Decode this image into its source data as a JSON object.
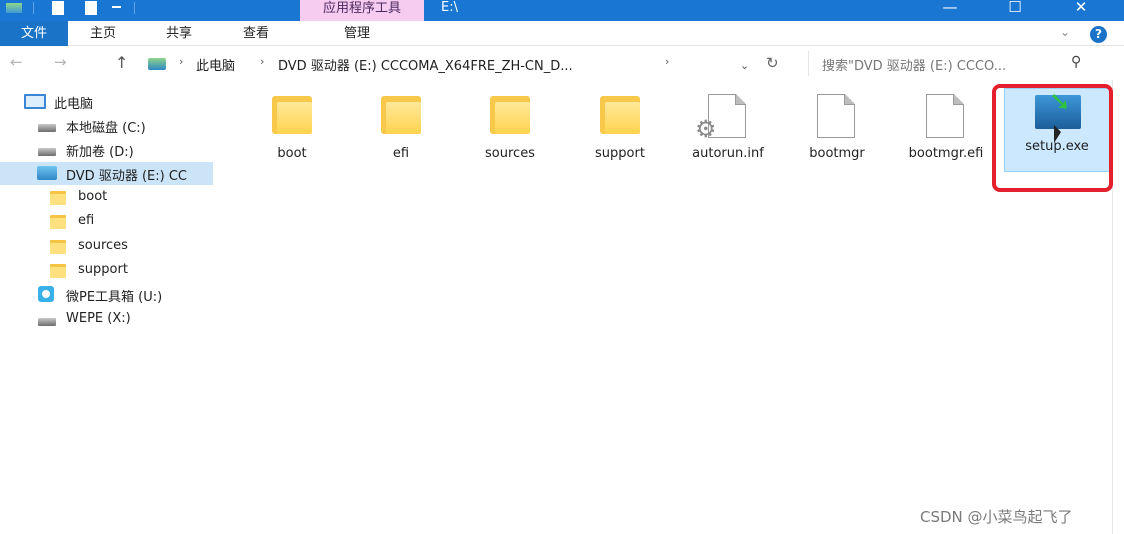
{
  "titlebar": {
    "context_tab": "应用程序工具",
    "window_title": "E:\\",
    "minimize": "—",
    "maximize": "☐",
    "close": "✕"
  },
  "ribbon": {
    "file": "文件",
    "tabs": [
      "主页",
      "共享",
      "查看",
      "管理"
    ],
    "help": "?"
  },
  "address": {
    "back": "←",
    "forward": "→",
    "up": "↑",
    "crumbs": [
      "此电脑",
      "DVD 驱动器 (E:) CCCOMA_X64FRE_ZH-CN_D..."
    ],
    "search_placeholder": "搜索\"DVD 驱动器 (E:) CCCO..."
  },
  "nav": {
    "items": [
      {
        "label": "此电脑",
        "icon": "computer-icon"
      },
      {
        "label": "本地磁盘 (C:)",
        "icon": "drive-icon"
      },
      {
        "label": "新加卷 (D:)",
        "icon": "drive-icon"
      },
      {
        "label": "DVD 驱动器 (E:) CC",
        "icon": "dvd-drive-icon"
      },
      {
        "label": "boot",
        "icon": "folder-icon"
      },
      {
        "label": "efi",
        "icon": "folder-icon"
      },
      {
        "label": "sources",
        "icon": "folder-icon"
      },
      {
        "label": "support",
        "icon": "folder-icon"
      },
      {
        "label": "微PE工具箱 (U:)",
        "icon": "usb-drive-icon"
      },
      {
        "label": "WEPE (X:)",
        "icon": "drive-icon"
      }
    ]
  },
  "files": [
    {
      "name": "boot",
      "type": "folder"
    },
    {
      "name": "efi",
      "type": "folder"
    },
    {
      "name": "sources",
      "type": "folder"
    },
    {
      "name": "support",
      "type": "folder"
    },
    {
      "name": "autorun.inf",
      "type": "settings-file"
    },
    {
      "name": "bootmgr",
      "type": "file"
    },
    {
      "name": "bootmgr.efi",
      "type": "file"
    },
    {
      "name": "setup.exe",
      "type": "application"
    }
  ],
  "colors": {
    "titlebar": "#1976d2",
    "context_tab": "#f6ccf0",
    "selection": "#cce8ff",
    "highlight_box": "#e3202c"
  },
  "watermark": "CSDN @小菜鸟起飞了"
}
